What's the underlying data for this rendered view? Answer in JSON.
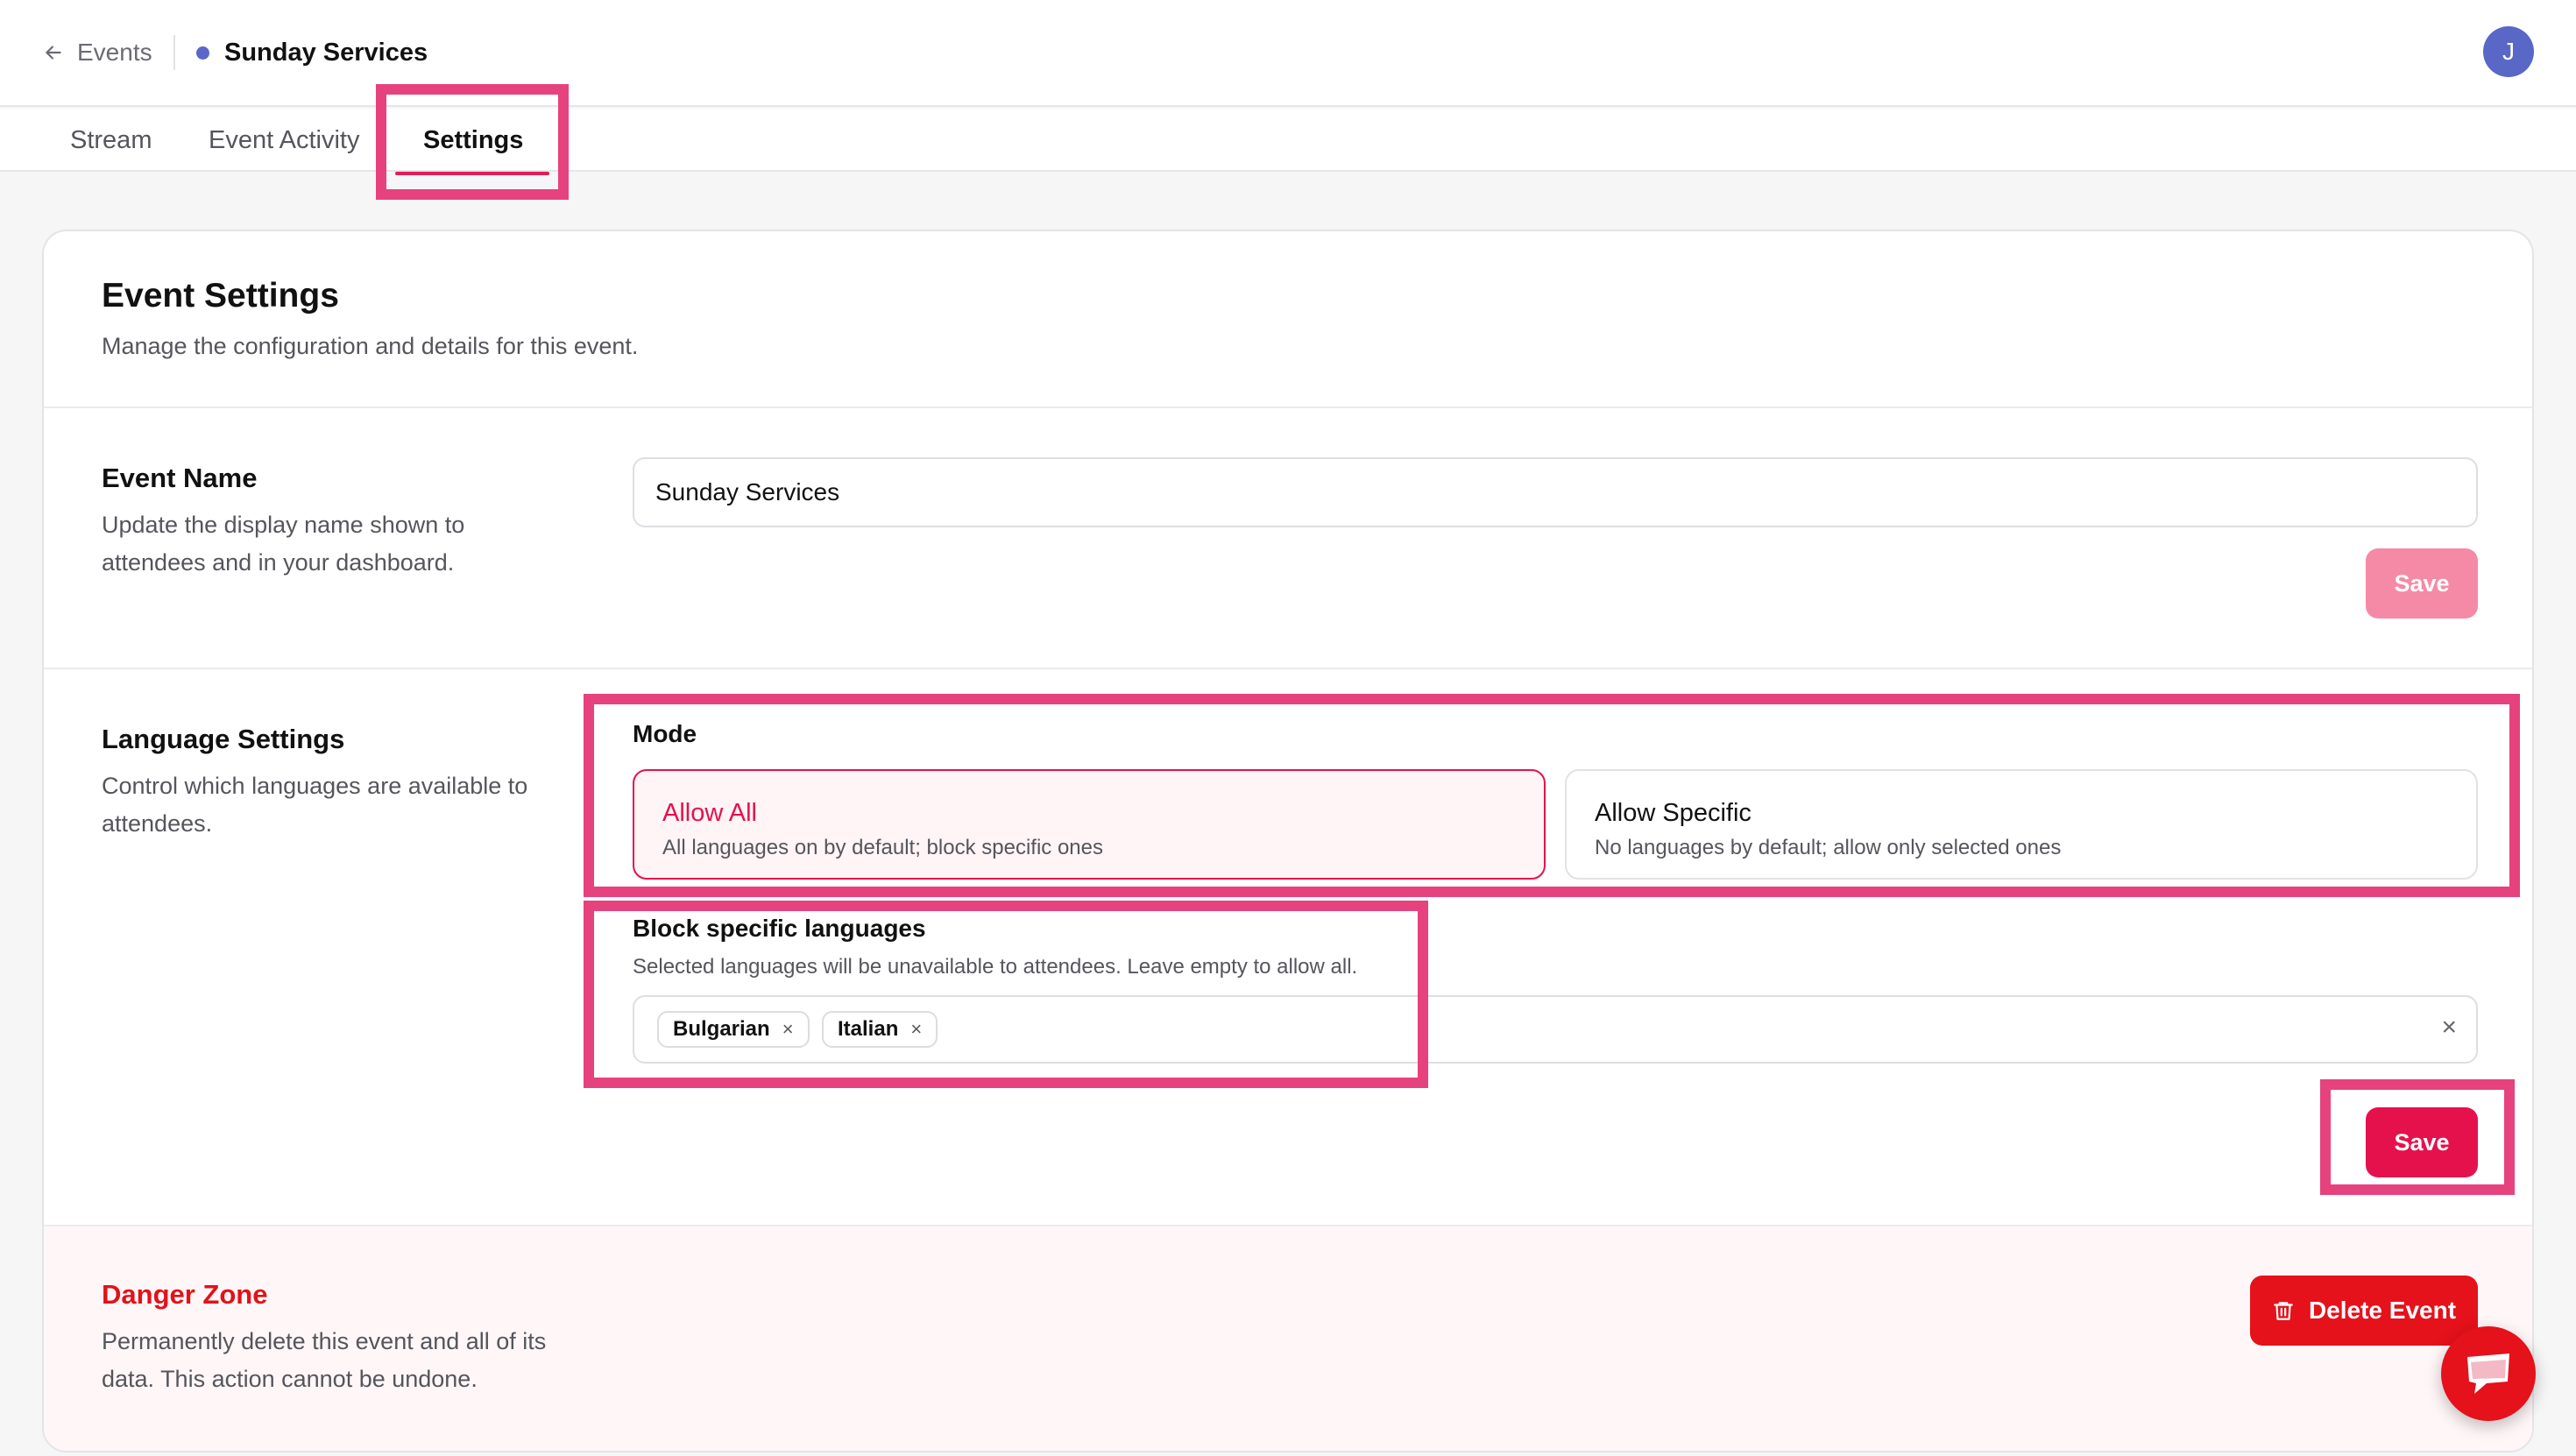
{
  "header": {
    "back_label": "Events",
    "event_title": "Sunday Services",
    "avatar_initial": "J",
    "dot_color": "#5a67c8"
  },
  "tabs": [
    {
      "label": "Stream",
      "active": false
    },
    {
      "label": "Event Activity",
      "active": false
    },
    {
      "label": "Settings",
      "active": true
    }
  ],
  "card": {
    "title": "Event Settings",
    "subtitle": "Manage the configuration and details for this event."
  },
  "event_name": {
    "title": "Event Name",
    "description": "Update the display name shown to attendees and in your dashboard.",
    "value": "Sunday Services",
    "save_label": "Save"
  },
  "language_settings": {
    "title": "Language Settings",
    "description": "Control which languages are available to attendees.",
    "mode_label": "Mode",
    "options": [
      {
        "title": "Allow All",
        "description": "All languages on by default; block specific ones",
        "selected": true
      },
      {
        "title": "Allow Specific",
        "description": "No languages by default; allow only selected ones",
        "selected": false
      }
    ],
    "block_title": "Block specific languages",
    "block_description": "Selected languages will be unavailable to attendees. Leave empty to allow all.",
    "selected_languages": [
      "Bulgarian",
      "Italian"
    ],
    "chip_remove": "×",
    "clear_all": "×",
    "save_label": "Save"
  },
  "danger_zone": {
    "title": "Danger Zone",
    "description": "Permanently delete this event and all of its data. This action cannot be undone.",
    "delete_label": "Delete Event"
  },
  "colors": {
    "accent": "#e5114d",
    "accent_disabled": "#f58aa6",
    "danger": "#e5111b",
    "highlight": "#e6427e",
    "avatar": "#5967c6"
  }
}
